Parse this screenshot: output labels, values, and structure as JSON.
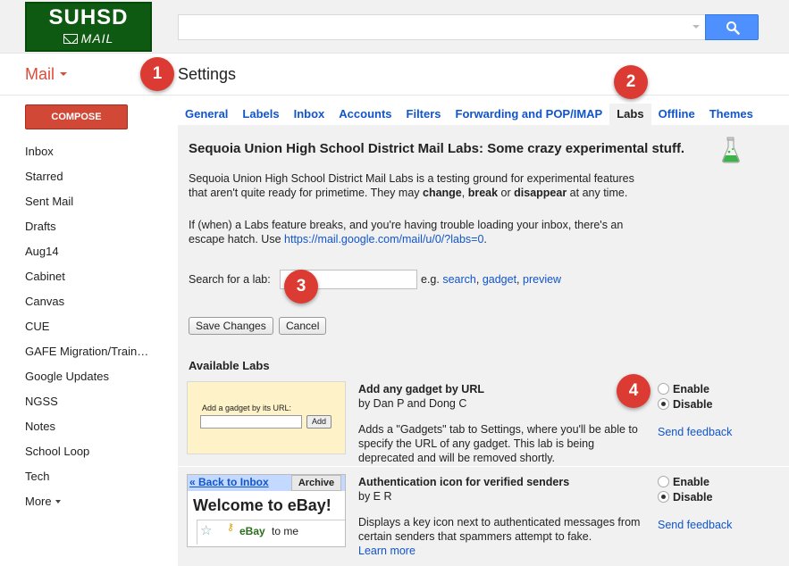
{
  "logo": {
    "line1": "SUHSD",
    "line2": "MAIL"
  },
  "search": {
    "placeholder": ""
  },
  "mail_label": "Mail",
  "page_title": "Settings",
  "compose_label": "COMPOSE",
  "nav": [
    "Inbox",
    "Starred",
    "Sent Mail",
    "Drafts",
    "Aug14",
    "Cabinet",
    "Canvas",
    "CUE",
    "GAFE Migration/Train…",
    "Google Updates",
    "NGSS",
    "Notes",
    "School Loop",
    "Tech"
  ],
  "nav_more": "More",
  "callouts": [
    "1",
    "2",
    "3",
    "4"
  ],
  "tabs": [
    "General",
    "Labels",
    "Inbox",
    "Accounts",
    "Filters",
    "Forwarding and POP/IMAP",
    "Labs",
    "Offline",
    "Themes"
  ],
  "labs": {
    "title": "Sequoia Union High School District Mail Labs: Some crazy experimental stuff.",
    "intro_a": "Sequoia Union High School District Mail Labs is a testing ground for experimental features that aren't quite ready for primetime. They may ",
    "intro_change": "change",
    "intro_comma": ", ",
    "intro_break": "break",
    "intro_or": " or ",
    "intro_disappear": "disappear",
    "intro_end": " at any time.",
    "escape_a": "If (when) a Labs feature breaks, and you're having trouble loading your inbox, there's an escape hatch. Use ",
    "escape_link": "https://mail.google.com/mail/u/0/?labs=0",
    "escape_end": ".",
    "search_label": "Search for a lab:",
    "eg_label": "e.g. ",
    "eg_links": [
      "search",
      "gadget",
      "preview"
    ],
    "save_label": "Save Changes",
    "cancel_label": "Cancel",
    "available_label": "Available Labs",
    "enable_label": "Enable",
    "disable_label": "Disable",
    "feedback_label": "Send feedback",
    "items": [
      {
        "name": "Add any gadget by URL",
        "by": "by Dan P and Dong C",
        "desc": "Adds a \"Gadgets\" tab to Settings, where you'll be able to specify the URL of any gadget. This lab is being deprecated and will be removed shortly.",
        "preview_label": "Add a gadget by its URL:",
        "preview_button": "Add",
        "selected": "disable"
      },
      {
        "name": "Authentication icon for verified senders",
        "by": "by E R",
        "desc": "Displays a key icon next to authenticated messages from certain senders that spammers attempt to fake.",
        "learn_more": "Learn more",
        "preview_back": "« Back to Inbox",
        "preview_archive": "Archive",
        "preview_heading": "Welcome to eBay!",
        "preview_sender": "eBay",
        "preview_to": "to me",
        "selected": "disable"
      }
    ]
  },
  "colors": {
    "accent_red": "#dd4b39",
    "link_blue": "#1155cc",
    "logo_green": "#0f5a12",
    "search_blue": "#4d90fe"
  }
}
